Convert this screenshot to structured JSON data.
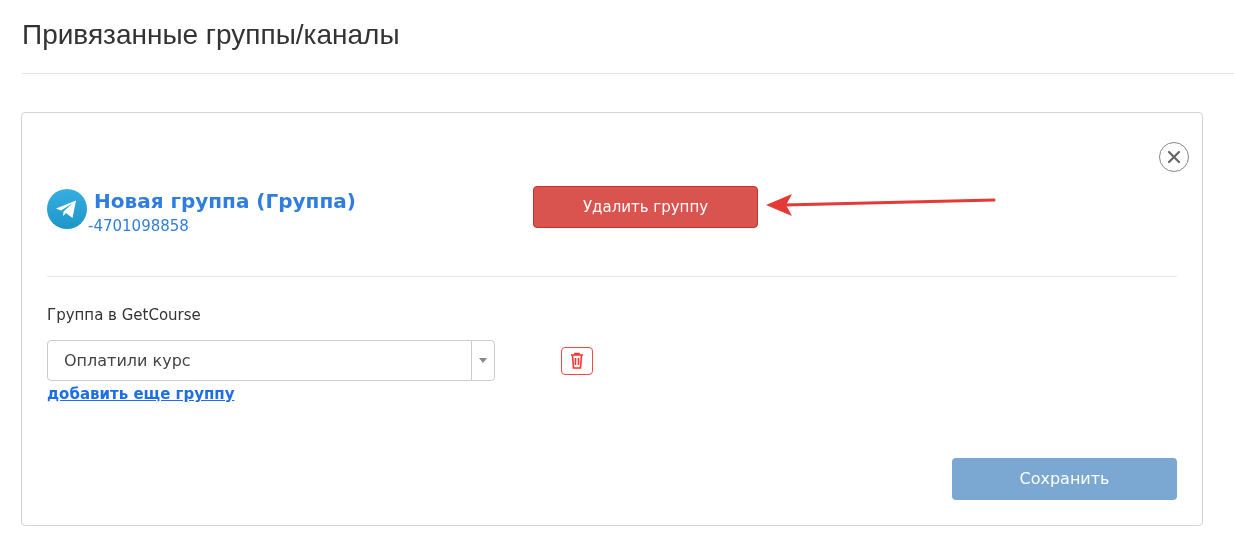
{
  "page_title": "Привязанные группы/каналы",
  "card": {
    "group_name": "Новая группа (Группа)",
    "group_id": "-4701098858",
    "delete_button": "Удалить группу",
    "field_label": "Группа в GetCourse",
    "selects": [
      {
        "value": "Оплатили курс"
      }
    ],
    "add_link": "добавить еще группу",
    "save_button": {
      "label": "Сохранить",
      "disabled": true
    }
  }
}
